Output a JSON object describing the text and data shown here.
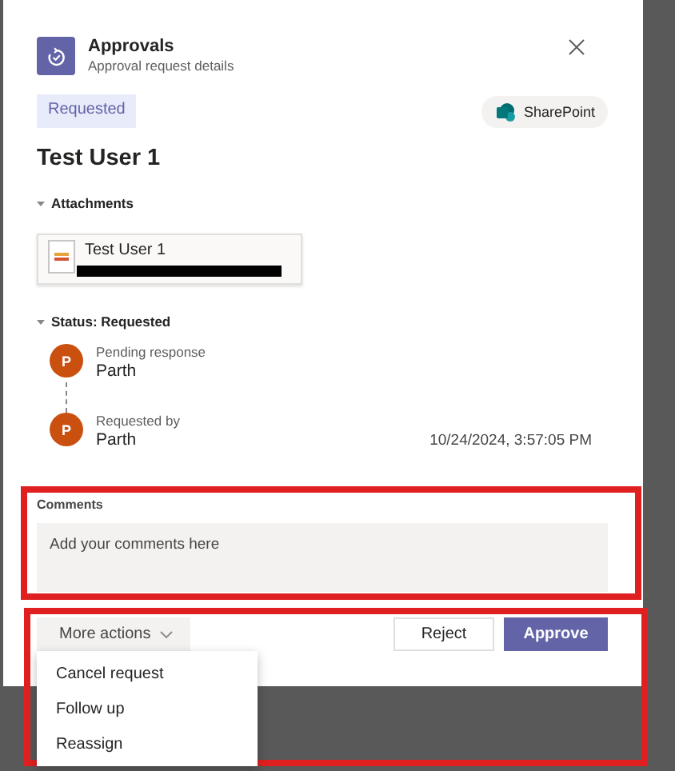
{
  "dialog": {
    "app_name": "Approvals",
    "subtitle": "Approval request details",
    "status_tag": "Requested",
    "source": "SharePoint",
    "title": "Test User 1",
    "attachments": {
      "heading": "Attachments",
      "expanded": true,
      "items": [
        {
          "name": "Test User 1",
          "redacted": true
        }
      ]
    },
    "status": {
      "heading": "Status: Requested",
      "expanded": true,
      "timeline": [
        {
          "initial": "P",
          "label": "Pending response",
          "name": "Parth",
          "color": "#ca5010"
        },
        {
          "initial": "P",
          "label": "Requested by",
          "name": "Parth",
          "time": "10/24/2024, 3:57:05 PM",
          "color": "#ca5010"
        }
      ]
    },
    "comments": {
      "label": "Comments",
      "placeholder": "Add your comments here",
      "annotated": true
    },
    "actions": {
      "annotated": true,
      "more_actions": {
        "label": "More actions",
        "expanded": true,
        "menu": [
          "Cancel request",
          "Follow up",
          "Reassign"
        ]
      },
      "buttons": [
        {
          "label": "Reject",
          "kind": "secondary"
        },
        {
          "label": "Approve",
          "kind": "primary"
        }
      ]
    }
  }
}
